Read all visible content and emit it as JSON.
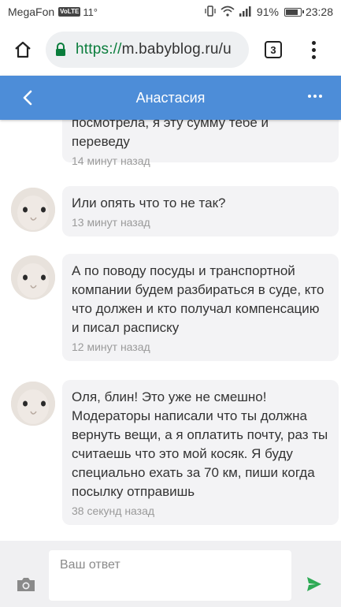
{
  "status_bar": {
    "carrier": "MegaFon",
    "network_badge": "VoLTE",
    "temperature": "11°",
    "battery_percent": "91%",
    "battery_level": 0.91,
    "time": "23:28",
    "icons": [
      "vibrate-icon",
      "wifi-icon",
      "signal-icon",
      "battery-icon"
    ]
  },
  "browser": {
    "url_scheme": "https://",
    "url_host": "m.babyblog.ru/u",
    "tab_count": "3",
    "scheme_color": "#0a7d3c"
  },
  "header": {
    "title": "Анастасия",
    "background_color": "#4d8dd8"
  },
  "messages": [
    {
      "text": "посмотрела, я эту сумму тебе и переведу",
      "time": "14 минут назад",
      "partial": true
    },
    {
      "text": "Или опять что то не так?",
      "time": "13 минут назад"
    },
    {
      "text": "А по поводу посуды и транспортной компании будем разбираться в суде, кто что должен и кто получал компенсацию и писал расписку",
      "time": "12 минут назад"
    },
    {
      "text": "Оля, блин! Это уже не смешно! Модераторы написали что ты должна вернуть вещи, а я оплатить почту, раз ты считаешь что это мой косяк. Я буду специально ехать за 70 км, пиши когда посылку отправишь",
      "time": "38 секунд назад"
    }
  ],
  "reply": {
    "placeholder": "Ваш ответ",
    "send_color": "#2eaa55"
  }
}
